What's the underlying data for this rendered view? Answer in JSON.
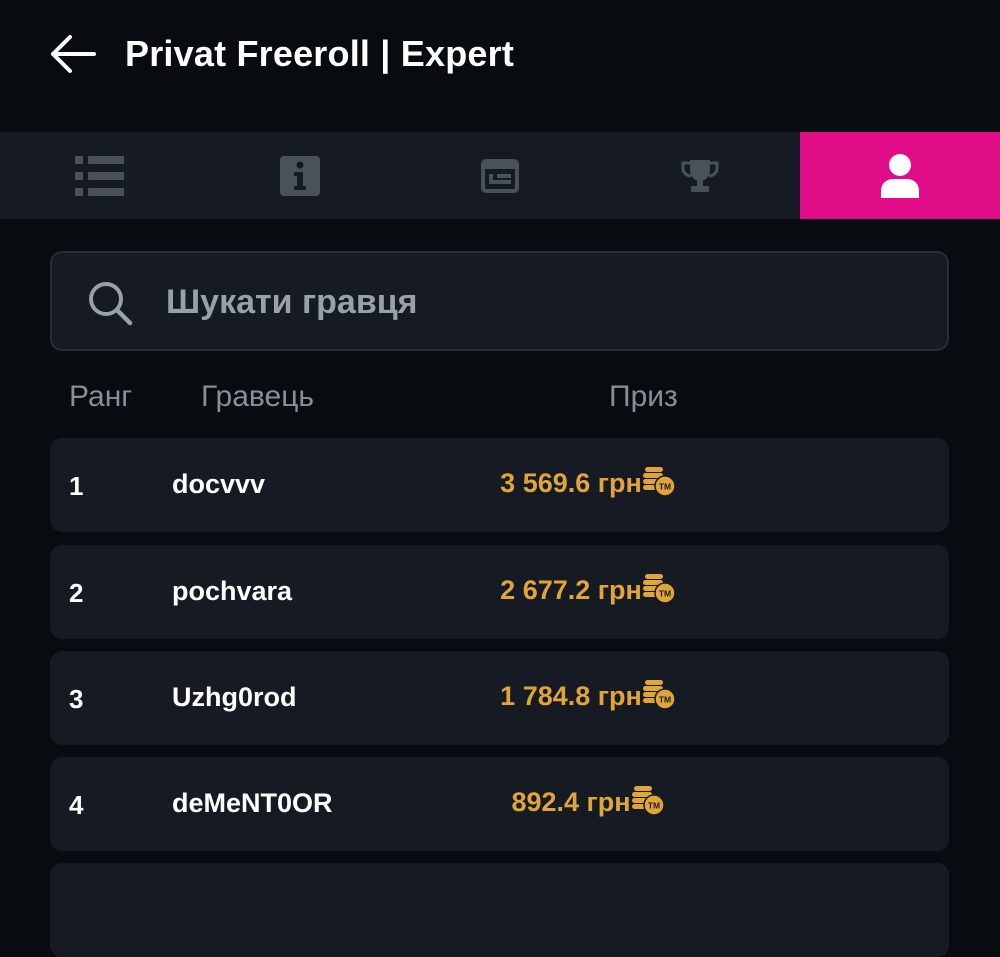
{
  "header": {
    "back_icon": "arrow-left-icon",
    "title": "Privat Freeroll | Expert"
  },
  "tabs": [
    {
      "icon": "list-icon",
      "active": false
    },
    {
      "icon": "info-icon",
      "active": false
    },
    {
      "icon": "ticket-icon",
      "active": false
    },
    {
      "icon": "trophy-icon",
      "active": false
    },
    {
      "icon": "user-icon",
      "active": true
    }
  ],
  "colors": {
    "background": "#080b0f",
    "panel": "#161b23",
    "accent": "#e10c87",
    "prize": "#e0a53a",
    "muted": "#8a8f96"
  },
  "search": {
    "placeholder": "Шукати гравця",
    "value": ""
  },
  "table": {
    "headers": {
      "rank": "Ранг",
      "player": "Гравець",
      "prize": "Приз"
    },
    "rows": [
      {
        "rank": "1",
        "player": "docvvv",
        "prize": "3 569.6 грн"
      },
      {
        "rank": "2",
        "player": "pochvara",
        "prize": "2 677.2 грн"
      },
      {
        "rank": "3",
        "player": "Uzhg0rod",
        "prize": "1 784.8 грн"
      },
      {
        "rank": "4",
        "player": "deMeNT0OR",
        "prize": "892.4 грн"
      },
      {
        "rank": "",
        "player": "",
        "prize": ""
      }
    ]
  }
}
